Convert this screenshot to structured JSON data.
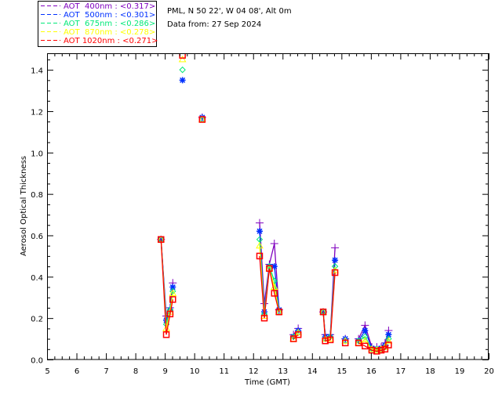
{
  "header": {
    "location": "PML, N 50 22', W 04 08', Alt 0m",
    "date": "Data from: 27 Sep 2024"
  },
  "chart_data": {
    "type": "line",
    "xlabel": "Time (GMT)",
    "ylabel": "Aerosol Optical Thickness",
    "xlim": [
      5,
      20
    ],
    "ylim": [
      0,
      1.48
    ],
    "xticks": [
      5,
      6,
      7,
      8,
      9,
      10,
      11,
      12,
      13,
      14,
      15,
      16,
      17,
      18,
      19,
      20
    ],
    "yticks": [
      "0.0",
      "0.2",
      "0.4",
      "0.6",
      "0.8",
      "1.0",
      "1.2",
      "1.4"
    ],
    "grid": false,
    "legend_placement": "top-left, outside plot",
    "x": [
      8.87,
      9.05,
      9.18,
      9.27,
      null,
      9.6,
      null,
      10.27,
      null,
      12.22,
      12.38,
      12.55,
      12.72,
      12.88,
      null,
      13.37,
      13.53,
      null,
      14.38,
      14.45,
      14.62,
      14.78,
      null,
      15.13,
      null,
      15.58,
      15.8,
      16.03,
      16.2,
      16.35,
      16.48,
      16.6
    ],
    "series": [
      {
        "name": "AOT  400nm : <0.317>",
        "color": "#7f00bf",
        "marker": "plus",
        "values": [
          0.58,
          0.21,
          0.25,
          0.37,
          null,
          1.52,
          null,
          1.17,
          null,
          0.66,
          0.27,
          0.46,
          0.56,
          0.24,
          null,
          0.12,
          0.15,
          null,
          0.23,
          0.12,
          0.12,
          0.54,
          null,
          0.1,
          null,
          0.1,
          0.165,
          0.06,
          0.06,
          0.06,
          0.08,
          0.14
        ]
      },
      {
        "name": "AOT  500nm : <0.301>",
        "color": "#0030ff",
        "marker": "asterisk",
        "values": [
          0.58,
          0.19,
          0.24,
          0.35,
          null,
          1.35,
          null,
          1.17,
          null,
          0.62,
          0.23,
          0.45,
          0.45,
          0.24,
          null,
          0.11,
          0.14,
          null,
          0.23,
          0.11,
          0.11,
          0.48,
          null,
          0.1,
          null,
          0.09,
          0.14,
          0.055,
          0.05,
          0.055,
          0.07,
          0.12
        ]
      },
      {
        "name": "AOT  675nm : <0.286>",
        "color": "#00e878",
        "marker": "diamond",
        "values": [
          0.58,
          0.17,
          0.24,
          0.33,
          null,
          1.4,
          null,
          1.16,
          null,
          0.58,
          0.22,
          0.45,
          0.38,
          0.23,
          null,
          0.11,
          0.13,
          null,
          0.23,
          0.1,
          0.11,
          0.45,
          null,
          0.09,
          null,
          0.09,
          0.11,
          0.05,
          0.05,
          0.05,
          0.06,
          0.1
        ]
      },
      {
        "name": "AOT  870nm : <0.278>",
        "color": "#ffff00",
        "marker": "triangle",
        "values": [
          0.58,
          0.15,
          0.23,
          0.32,
          null,
          1.45,
          null,
          1.16,
          null,
          0.55,
          0.21,
          0.44,
          0.35,
          0.23,
          null,
          0.1,
          0.13,
          null,
          0.23,
          0.1,
          0.1,
          0.43,
          null,
          0.09,
          null,
          0.08,
          0.09,
          0.05,
          0.045,
          0.05,
          0.06,
          0.09
        ]
      },
      {
        "name": "AOT 1020nm : <0.271>",
        "color": "#ff0000",
        "marker": "square",
        "values": [
          0.58,
          0.12,
          0.22,
          0.29,
          null,
          1.47,
          null,
          1.16,
          null,
          0.5,
          0.2,
          0.44,
          0.32,
          0.23,
          null,
          0.1,
          0.12,
          null,
          0.23,
          0.09,
          0.095,
          0.42,
          null,
          0.08,
          null,
          0.08,
          0.065,
          0.045,
          0.04,
          0.045,
          0.05,
          0.07
        ]
      }
    ]
  }
}
